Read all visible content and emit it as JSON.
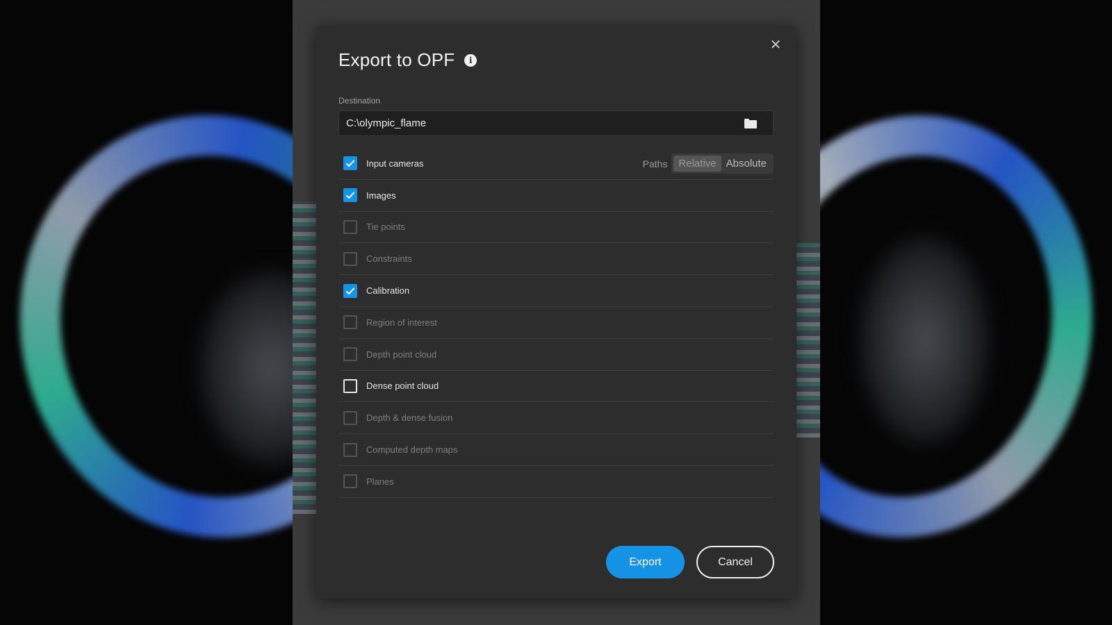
{
  "dialog": {
    "title": "Export to OPF",
    "info_icon": "info-icon",
    "close_icon": "close-icon",
    "close_glyph": "✕"
  },
  "destination": {
    "label": "Destination",
    "value": "C:\\olympic_flame",
    "browse_icon": "folder-icon"
  },
  "paths": {
    "label": "Paths",
    "options": [
      "Relative",
      "Absolute"
    ],
    "selected": "Relative"
  },
  "options": [
    {
      "label": "Input cameras",
      "checked": true,
      "enabled": true
    },
    {
      "label": "Images",
      "checked": true,
      "enabled": true
    },
    {
      "label": "Tie points",
      "checked": false,
      "enabled": false
    },
    {
      "label": "Constraints",
      "checked": false,
      "enabled": false
    },
    {
      "label": "Calibration",
      "checked": true,
      "enabled": true
    },
    {
      "label": "Region of interest",
      "checked": false,
      "enabled": false
    },
    {
      "label": "Depth point cloud",
      "checked": false,
      "enabled": false
    },
    {
      "label": "Dense point cloud",
      "checked": false,
      "enabled": true
    },
    {
      "label": "Depth & dense fusion",
      "checked": false,
      "enabled": false
    },
    {
      "label": "Computed depth maps",
      "checked": false,
      "enabled": false
    },
    {
      "label": "Planes",
      "checked": false,
      "enabled": false
    }
  ],
  "buttons": {
    "export_label": "Export",
    "cancel_label": "Cancel"
  },
  "colors": {
    "accent": "#1793e6",
    "dialog_bg": "#2d2d2d"
  }
}
